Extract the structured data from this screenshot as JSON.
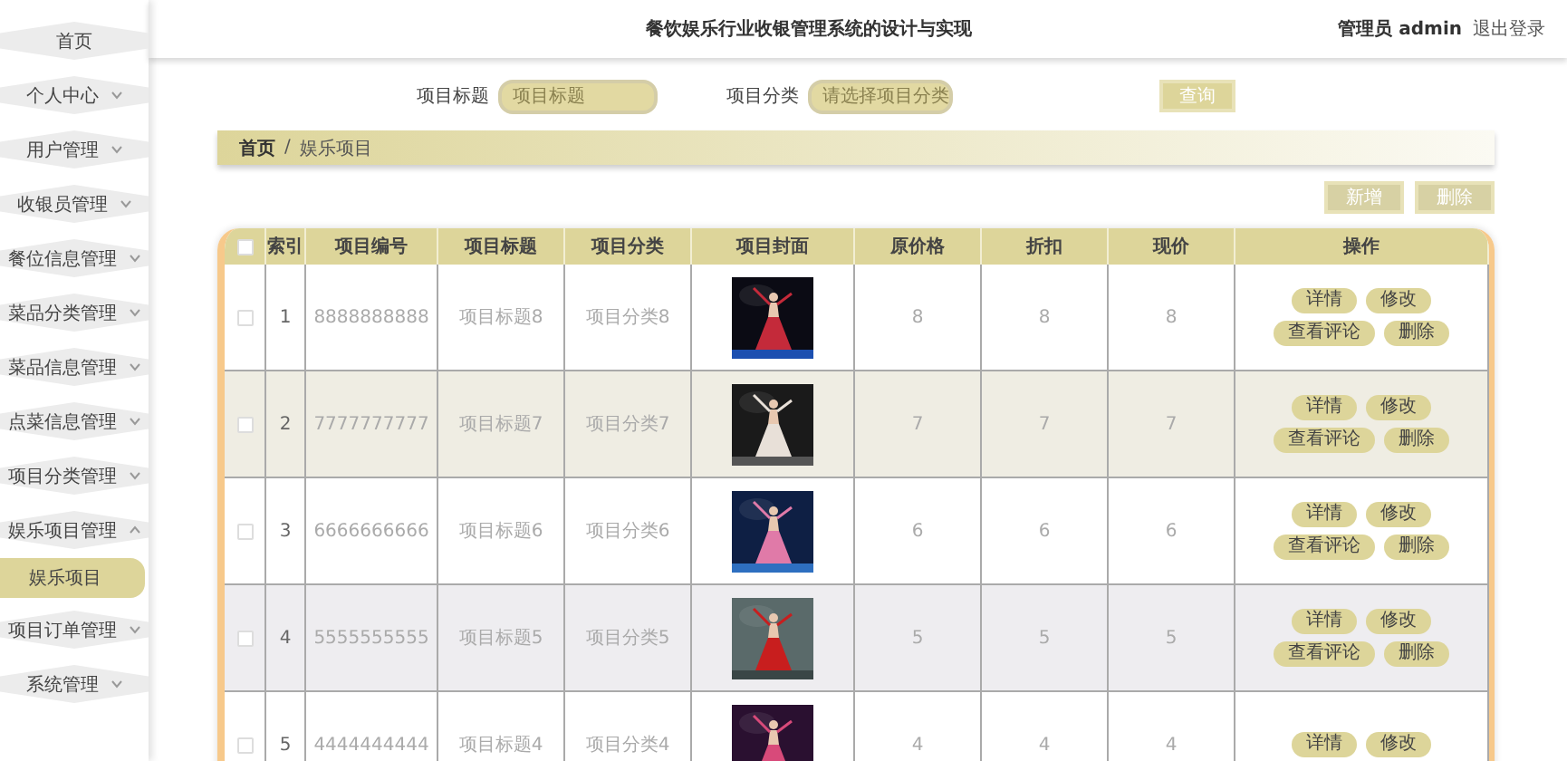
{
  "header": {
    "title": "餐饮娱乐行业收银管理系统的设计与实现",
    "user": "管理员 admin",
    "logout": "退出登录"
  },
  "sidebar": {
    "items": [
      {
        "label": "首页"
      },
      {
        "label": "个人中心",
        "expanded": false
      },
      {
        "label": "用户管理",
        "expanded": false
      },
      {
        "label": "收银员管理",
        "expanded": false
      },
      {
        "label": "餐位信息管理",
        "expanded": false
      },
      {
        "label": "菜品分类管理",
        "expanded": false
      },
      {
        "label": "菜品信息管理",
        "expanded": false
      },
      {
        "label": "点菜信息管理",
        "expanded": false
      },
      {
        "label": "项目分类管理",
        "expanded": false
      },
      {
        "label": "娱乐项目管理",
        "expanded": true,
        "children": [
          {
            "label": "娱乐项目",
            "selected": true
          }
        ]
      },
      {
        "label": "项目订单管理",
        "expanded": false
      },
      {
        "label": "系统管理",
        "expanded": false
      }
    ]
  },
  "search": {
    "fields": [
      {
        "label": "项目标题",
        "placeholder": "项目标题",
        "kind": "input"
      },
      {
        "label": "项目分类",
        "placeholder": "请选择项目分类",
        "kind": "select"
      }
    ],
    "button": "查询"
  },
  "breadcrumb": {
    "separator": "/",
    "items": [
      "首页",
      "娱乐项目"
    ]
  },
  "actions": [
    "新增",
    "删除"
  ],
  "table": {
    "select_all": {
      "checked": false
    },
    "columns": [
      "索引",
      "项目编号",
      "项目标题",
      "项目分类",
      "项目封面",
      "原价格",
      "折扣",
      "现价",
      "操作"
    ],
    "rows": [
      {
        "checked": false,
        "cells": [
          "1",
          "8888888888",
          "项目标题8",
          "项目分类8"
        ],
        "cover": {
          "kind": "picture"
        },
        "prices": [
          "8",
          "8",
          "8"
        ],
        "buttons": [
          "详情",
          "修改",
          "查看评论",
          "删除"
        ]
      },
      {
        "checked": false,
        "cells": [
          "2",
          "7777777777",
          "项目标题7",
          "项目分类7"
        ],
        "cover": {
          "kind": "picture"
        },
        "prices": [
          "7",
          "7",
          "7"
        ],
        "buttons": [
          "详情",
          "修改",
          "查看评论",
          "删除"
        ]
      },
      {
        "checked": false,
        "cells": [
          "3",
          "6666666666",
          "项目标题6",
          "项目分类6"
        ],
        "cover": {
          "kind": "picture"
        },
        "prices": [
          "6",
          "6",
          "6"
        ],
        "buttons": [
          "详情",
          "修改",
          "查看评论",
          "删除"
        ]
      },
      {
        "checked": false,
        "cells": [
          "4",
          "5555555555",
          "项目标题5",
          "项目分类5"
        ],
        "cover": {
          "kind": "picture"
        },
        "prices": [
          "5",
          "5",
          "5"
        ],
        "buttons": [
          "详情",
          "修改",
          "查看评论",
          "删除"
        ]
      },
      {
        "checked": false,
        "cells": [
          "5",
          "4444444444",
          "项目标题4",
          "项目分类4"
        ],
        "cover": {
          "kind": "picture"
        },
        "prices": [
          "4",
          "4",
          "4"
        ],
        "buttons": [
          "详情",
          "修改"
        ]
      }
    ]
  }
}
